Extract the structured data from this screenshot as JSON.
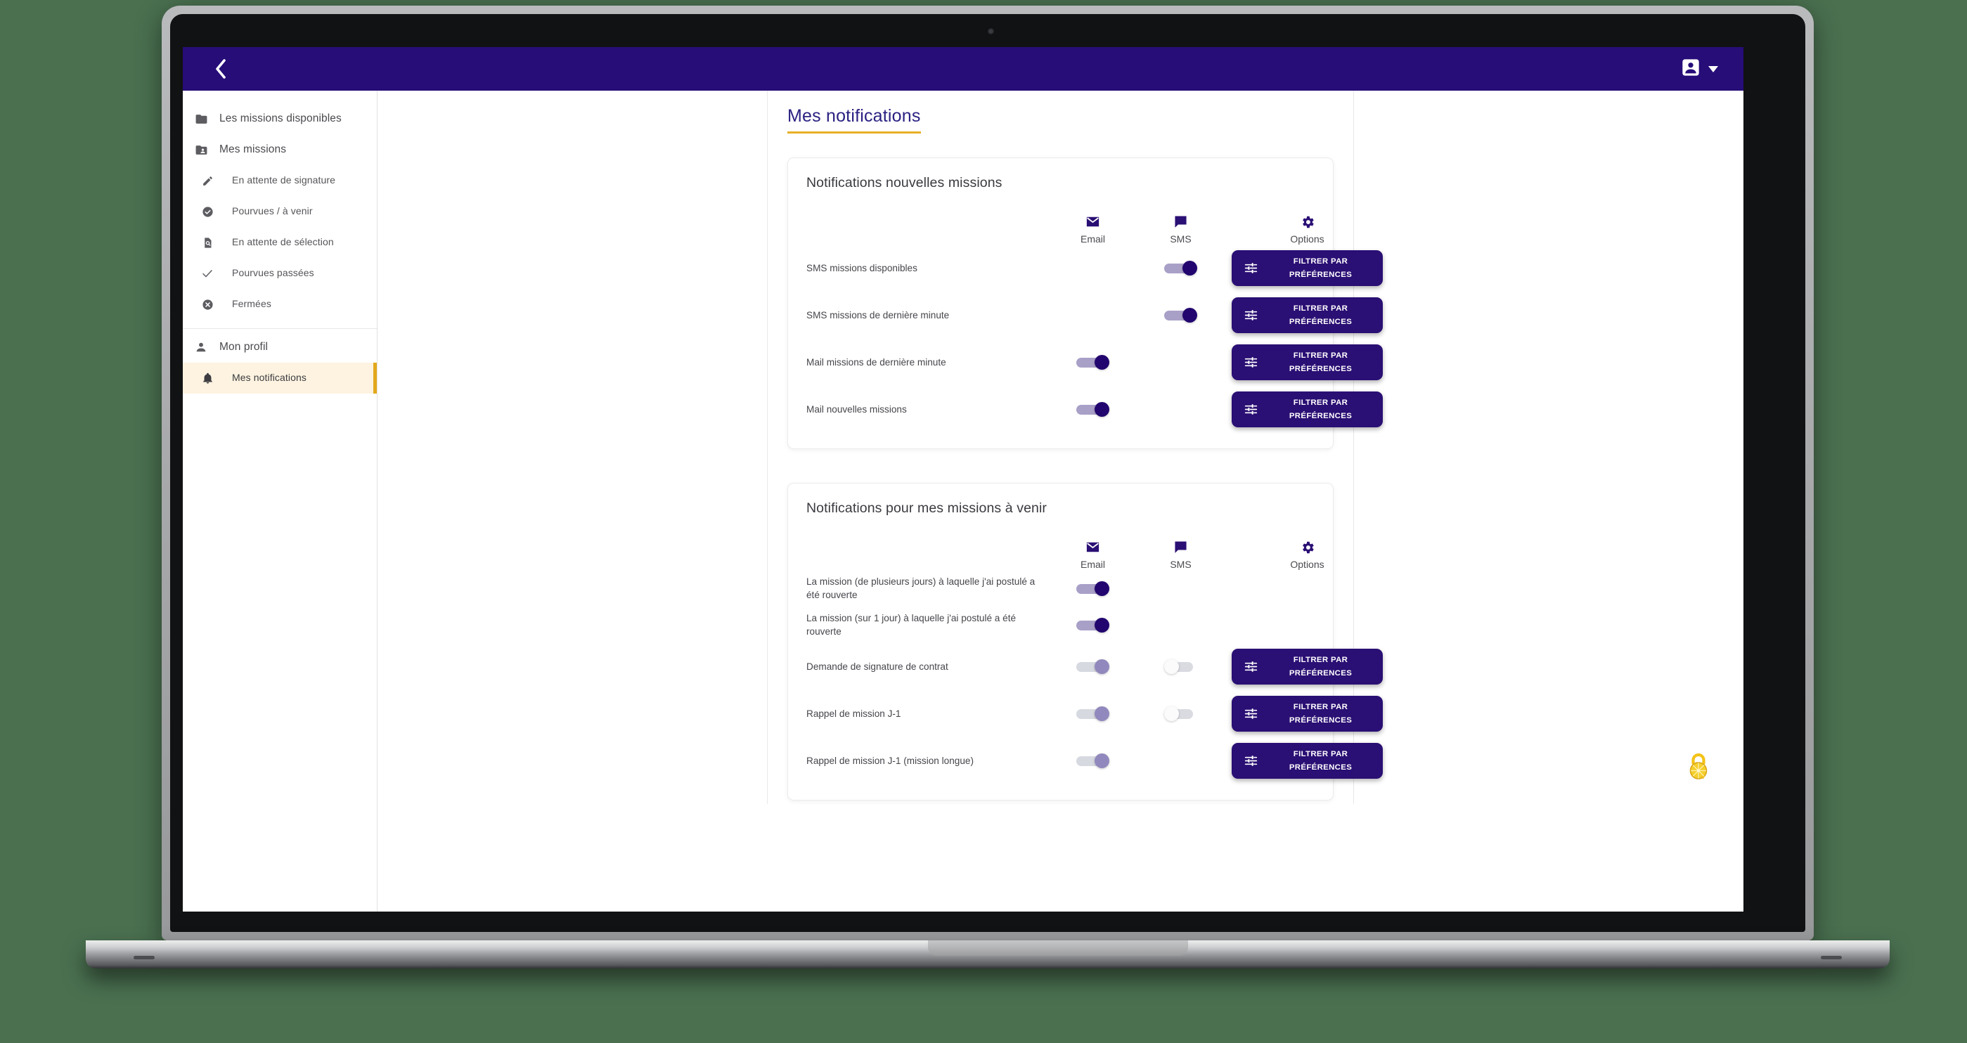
{
  "topnav": {
    "back_icon": "chevron-left-icon",
    "user_icon": "account-box-icon",
    "caret_icon": "caret-down-icon",
    "bg_color": "#260d78"
  },
  "sidebar": {
    "groups": [
      {
        "items": [
          {
            "label": "Les missions disponibles",
            "icon": "folder-icon",
            "level": "top",
            "active": false
          },
          {
            "label": "Mes missions",
            "icon": "folder-account-icon",
            "level": "top",
            "active": false
          },
          {
            "label": "En attente de signature",
            "icon": "pencil-icon",
            "level": "sub",
            "active": false
          },
          {
            "label": "Pourvues / à venir",
            "icon": "check-circle-icon",
            "level": "sub",
            "active": false
          },
          {
            "label": "En attente de sélection",
            "icon": "file-search-icon",
            "level": "sub",
            "active": false
          },
          {
            "label": "Pourvues passées",
            "icon": "check-icon",
            "level": "sub",
            "active": false
          },
          {
            "label": "Fermées",
            "icon": "close-circle-icon",
            "level": "sub",
            "active": false
          }
        ]
      },
      {
        "items": [
          {
            "label": "Mon profil",
            "icon": "account-icon",
            "level": "top",
            "active": false
          },
          {
            "label": "Mes notifications",
            "icon": "bell-icon",
            "level": "sub",
            "active": true
          }
        ]
      }
    ],
    "active_bg": "#fdf3e0",
    "active_bar": "#e3a81c"
  },
  "page": {
    "title": "Mes notifications",
    "title_color": "#2b2182",
    "underline_color": "#e7b027"
  },
  "columns": {
    "email": {
      "label": "Email",
      "icon": "email-icon"
    },
    "sms": {
      "label": "SMS",
      "icon": "message-icon"
    },
    "options": {
      "label": "Options",
      "icon": "gear-icon"
    }
  },
  "filter_button": {
    "line1": "FILTRER PAR",
    "line2": "PRÉFÉRENCES",
    "icon": "tune-icon",
    "bg": "#2a0f74"
  },
  "cards": [
    {
      "title": "Notifications nouvelles missions",
      "rows": [
        {
          "label": "SMS missions disponibles",
          "email": "none",
          "sms": "on",
          "options": true
        },
        {
          "label": "SMS missions de dernière minute",
          "email": "none",
          "sms": "on",
          "options": true
        },
        {
          "label": "Mail missions de dernière minute",
          "email": "on",
          "sms": "none",
          "options": true
        },
        {
          "label": "Mail nouvelles missions",
          "email": "on",
          "sms": "none",
          "options": true
        }
      ]
    },
    {
      "title": "Notifications pour mes missions à venir",
      "rows": [
        {
          "label": "La mission (de plusieurs jours) à laquelle j'ai postulé a été rouverte",
          "email": "on",
          "sms": "none",
          "options": false
        },
        {
          "label": "La mission (sur 1 jour) à laquelle j'ai postulé a été rouverte",
          "email": "on",
          "sms": "none",
          "options": false
        },
        {
          "label": "Demande de signature de contrat",
          "email": "mid",
          "sms": "off",
          "options": true
        },
        {
          "label": "Rappel de mission J-1",
          "email": "mid",
          "sms": "off",
          "options": true
        },
        {
          "label": "Rappel de mission J-1 (mission longue)",
          "email": "mid",
          "sms": "none",
          "options": true
        }
      ]
    }
  ],
  "lock_badge": {
    "icon": "lock-icon",
    "color": "#f5c518"
  }
}
